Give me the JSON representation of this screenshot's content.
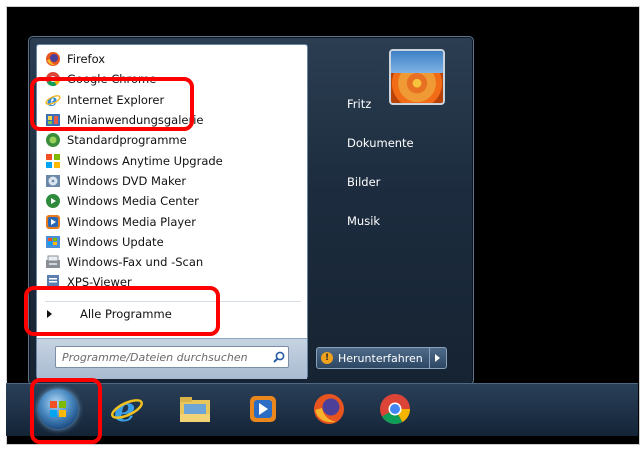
{
  "start_menu": {
    "programs": [
      {
        "label": "Firefox",
        "icon": "firefox-icon"
      },
      {
        "label": "Google Chrome",
        "icon": "chrome-icon"
      },
      {
        "label": "Internet Explorer",
        "icon": "internet-explorer-icon"
      },
      {
        "label": "Minianwendungsgalerie",
        "icon": "gadget-gallery-icon"
      },
      {
        "label": "Standardprogramme",
        "icon": "default-programs-icon"
      },
      {
        "label": "Windows Anytime Upgrade",
        "icon": "anytime-upgrade-icon"
      },
      {
        "label": "Windows DVD Maker",
        "icon": "dvd-maker-icon"
      },
      {
        "label": "Windows Media Center",
        "icon": "media-center-icon"
      },
      {
        "label": "Windows Media Player",
        "icon": "media-player-icon"
      },
      {
        "label": "Windows Update",
        "icon": "windows-update-icon"
      },
      {
        "label": "Windows-Fax und -Scan",
        "icon": "fax-scan-icon"
      },
      {
        "label": "XPS-Viewer",
        "icon": "xps-viewer-icon"
      }
    ],
    "all_programs_label": "Alle Programme",
    "search_placeholder": "Programme/Dateien durchsuchen",
    "right_items": [
      "Fritz",
      "Dokumente",
      "Bilder",
      "Musik"
    ],
    "shutdown_label": "Herunterfahren"
  },
  "taskbar": {
    "icons": [
      "start-orb-icon",
      "internet-explorer-icon",
      "explorer-folder-icon",
      "media-player-icon",
      "firefox-icon",
      "chrome-icon"
    ]
  },
  "colors": {
    "highlight": "#ff0000",
    "menu_dark": "#1c2c3e",
    "taskbar": "#142437"
  }
}
